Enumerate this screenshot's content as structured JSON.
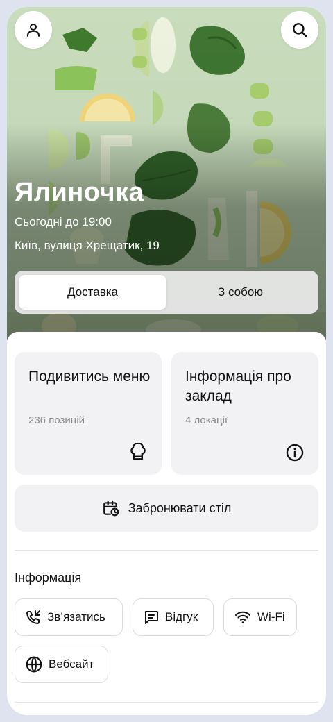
{
  "header": {
    "profile_icon": "user-icon",
    "search_icon": "search-icon"
  },
  "place": {
    "name": "Ялиночка",
    "hours": "Сьогодні до 19:00",
    "address": "Київ, вулиця Хрещатик, 19"
  },
  "order_mode": {
    "options": [
      "Доставка",
      "З собою"
    ],
    "selected": "Доставка"
  },
  "cards": {
    "menu": {
      "title": "Подивитись меню",
      "subtitle": "236 позицій",
      "icon": "chef-hat-icon"
    },
    "info": {
      "title": "Інформація про заклад",
      "subtitle": "4 локації",
      "icon": "info-icon"
    }
  },
  "booking": {
    "label": "Забронювати стіл",
    "icon": "calendar-clock-icon"
  },
  "info_section": {
    "title": "Інформація",
    "chips": [
      {
        "label": "Зв’язатись",
        "icon": "phone-icon"
      },
      {
        "label": "Відгук",
        "icon": "message-icon"
      },
      {
        "label": "Wi-Fi",
        "icon": "wifi-icon"
      },
      {
        "label": "Вебсайт",
        "icon": "globe-icon"
      }
    ]
  },
  "colors": {
    "page_bg": "#dfe3ef",
    "card_bg": "#f2f2f4",
    "hero_green": "#c8dcbc"
  }
}
